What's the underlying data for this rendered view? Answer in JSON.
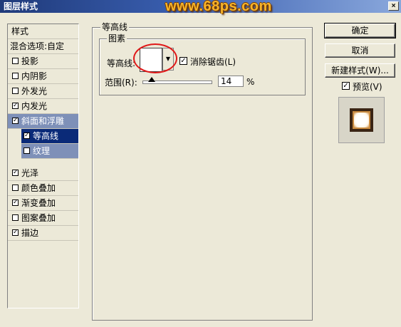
{
  "window": {
    "title": "图层样式",
    "close_label": "×",
    "watermark": "www.68ps.com"
  },
  "styles_panel": {
    "header": "样式",
    "blend_options": "混合选项:自定",
    "items": [
      {
        "label": "投影",
        "checked": false
      },
      {
        "label": "内阴影",
        "checked": false
      },
      {
        "label": "外发光",
        "checked": false
      },
      {
        "label": "内发光",
        "checked": true
      },
      {
        "label": "斜面和浮雕",
        "checked": true
      },
      {
        "label": "等高线",
        "checked": true
      },
      {
        "label": "纹理",
        "checked": false
      },
      {
        "label": "光泽",
        "checked": true
      },
      {
        "label": "颜色叠加",
        "checked": false
      },
      {
        "label": "渐变叠加",
        "checked": true
      },
      {
        "label": "图案叠加",
        "checked": false
      },
      {
        "label": "描边",
        "checked": true
      }
    ]
  },
  "contour_section": {
    "title": "等高线",
    "group_title": "图素",
    "contour_label": "等高线:",
    "anti_alias_label": "消除锯齿(L)",
    "anti_alias_checked": true,
    "range_label": "范围(R):",
    "range_value": "14",
    "range_unit": "%"
  },
  "buttons": {
    "ok": "确定",
    "cancel": "取消",
    "new_style": "新建样式(W)...",
    "preview_label": "预览(V)",
    "preview_checked": true
  },
  "check_mark": "✓"
}
